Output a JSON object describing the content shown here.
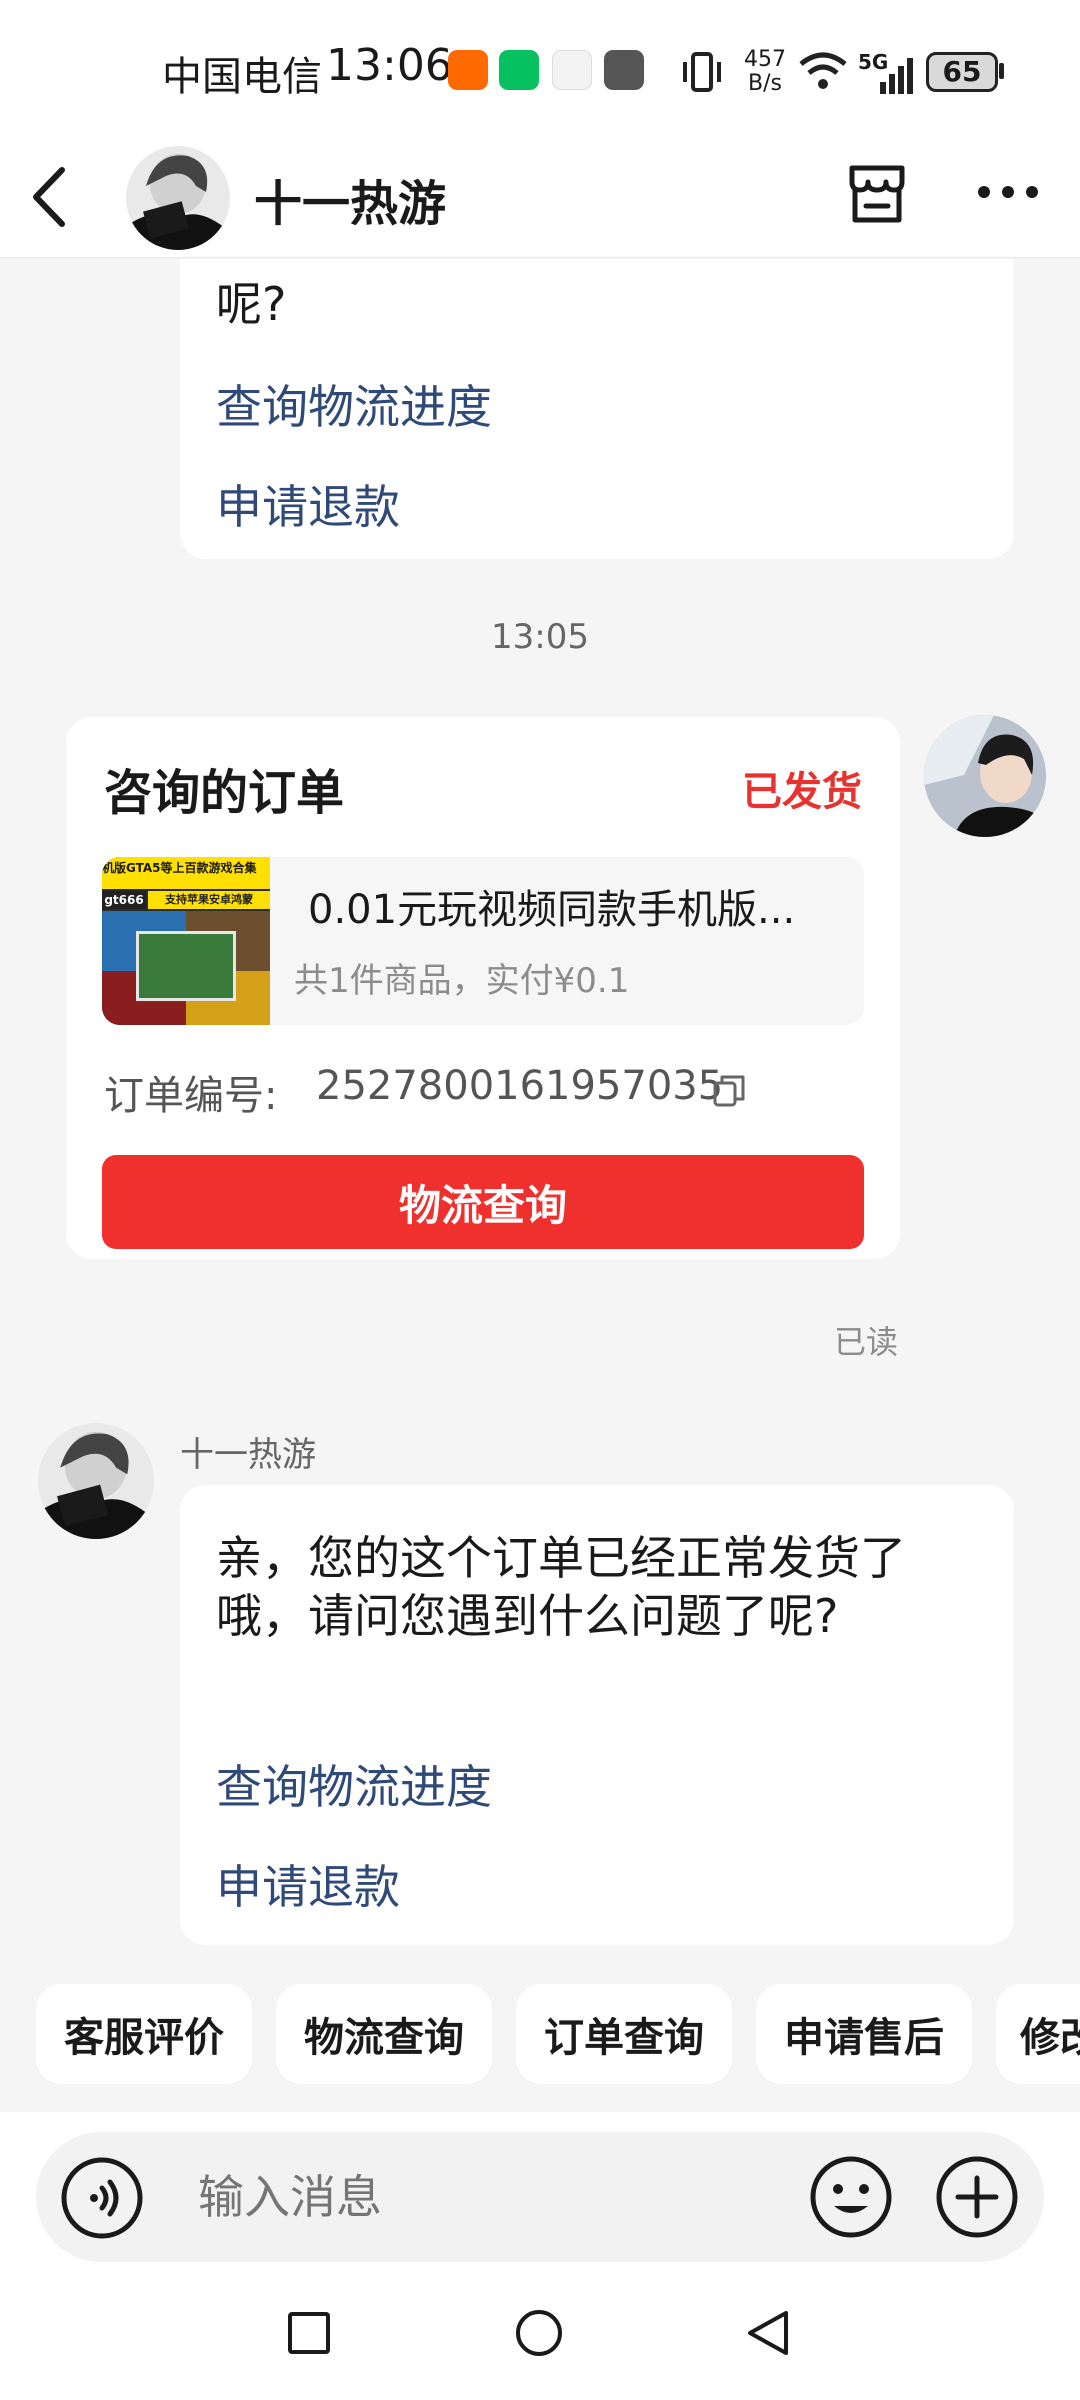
{
  "status_bar": {
    "carrier": "中国电信",
    "time": "13:06",
    "net_speed_top": "457",
    "net_speed_bottom": "B/s",
    "signal": "5G",
    "battery": "65"
  },
  "header": {
    "shop_name": "十一热游",
    "icons": [
      "back-arrow-icon",
      "store-icon",
      "more-icon"
    ]
  },
  "chat": {
    "top_message": {
      "tail_text": "呢?",
      "links": [
        "查询物流进度",
        "申请退款"
      ]
    },
    "timestamp": "13:05",
    "order_card": {
      "title": "咨询的订单",
      "status": "已发货",
      "status_color": "#e8322f",
      "product_name": "0.01元玩视频同款手机版...",
      "summary": "共1件商品，实付¥0.1",
      "thumb_text_top": "机版GTA5等上百款游戏合集",
      "thumb_tag": "gt666",
      "thumb_tag2": "支持苹果安卓鸿蒙",
      "order_no_label": "订单编号:",
      "order_no": "2527800161957035",
      "button_label": "物流查询",
      "button_color": "#f0302d"
    },
    "read_status": "已读",
    "reply": {
      "sender": "十一热游",
      "text": "亲，您的这个订单已经正常发货了哦，请问您遇到什么问题了呢?",
      "links": [
        "查询物流进度",
        "申请退款"
      ]
    }
  },
  "quick_actions": [
    "客服评价",
    "物流查询",
    "订单查询",
    "申请售后",
    "修改"
  ],
  "input": {
    "placeholder": "输入消息",
    "icons": [
      "voice-icon",
      "emoji-icon",
      "plus-icon"
    ]
  },
  "nav_bar": {
    "icons": [
      "recent-apps-icon",
      "home-icon",
      "back-icon"
    ]
  }
}
